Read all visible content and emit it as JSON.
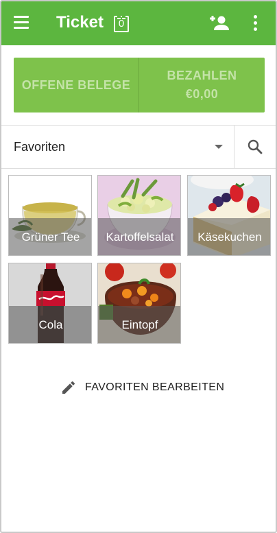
{
  "appbar": {
    "title": "Ticket",
    "ticket_count": "0",
    "icons": [
      "menu-icon",
      "add-customer-icon",
      "more-vert-icon"
    ]
  },
  "actions": {
    "open_receipts_label": "OFFENE BELEGE",
    "pay_label": "BEZAHLEN",
    "pay_amount": "€0,00"
  },
  "category": {
    "selected": "Favoriten"
  },
  "items": [
    {
      "name": "Grüner Tee",
      "image": "green-tea-cup"
    },
    {
      "name": "Kartoffelsalat",
      "image": "potato-salad-bowl"
    },
    {
      "name": "Käsekuchen",
      "image": "cheesecake-with-berries"
    },
    {
      "name": "Cola",
      "image": "coca-cola-bottle"
    },
    {
      "name": "Eintopf",
      "image": "stew-in-pot"
    }
  ],
  "footer": {
    "edit_favorites_label": "FAVORITEN BEARBEITEN"
  },
  "colors": {
    "appbar": "#5cb63f",
    "action_button": "#7ec24b",
    "action_text": "#c4e3a8"
  }
}
